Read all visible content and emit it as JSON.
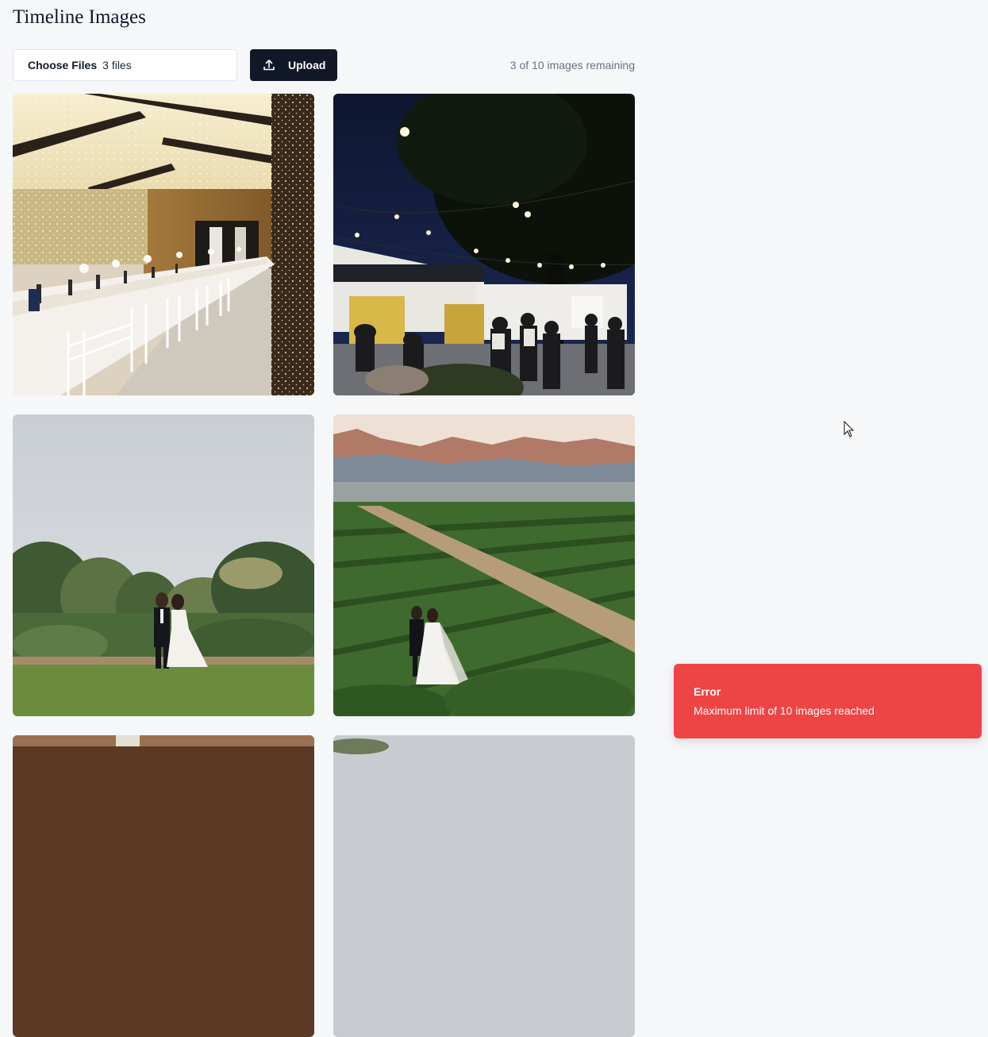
{
  "page": {
    "title": "Timeline Images"
  },
  "upload": {
    "choose_files_label": "Choose Files",
    "file_count": "3 files",
    "upload_label": "Upload",
    "upload_icon": "upload-icon",
    "remaining": "3 of 10 images remaining"
  },
  "images": [
    {
      "subject": "reception-hall-fairy-lights"
    },
    {
      "subject": "night-courtyard-string-lights"
    },
    {
      "subject": "couple-in-garden"
    },
    {
      "subject": "couple-in-vineyard-mountains"
    },
    {
      "subject": "partial-image-5"
    },
    {
      "subject": "partial-image-6"
    }
  ],
  "toast": {
    "title": "Error",
    "message": "Maximum limit of 10 images reached",
    "color": "#ef4444"
  },
  "colors": {
    "background": "#f6f7f9",
    "primary_button": "#111827",
    "muted_text": "#6b7280"
  }
}
